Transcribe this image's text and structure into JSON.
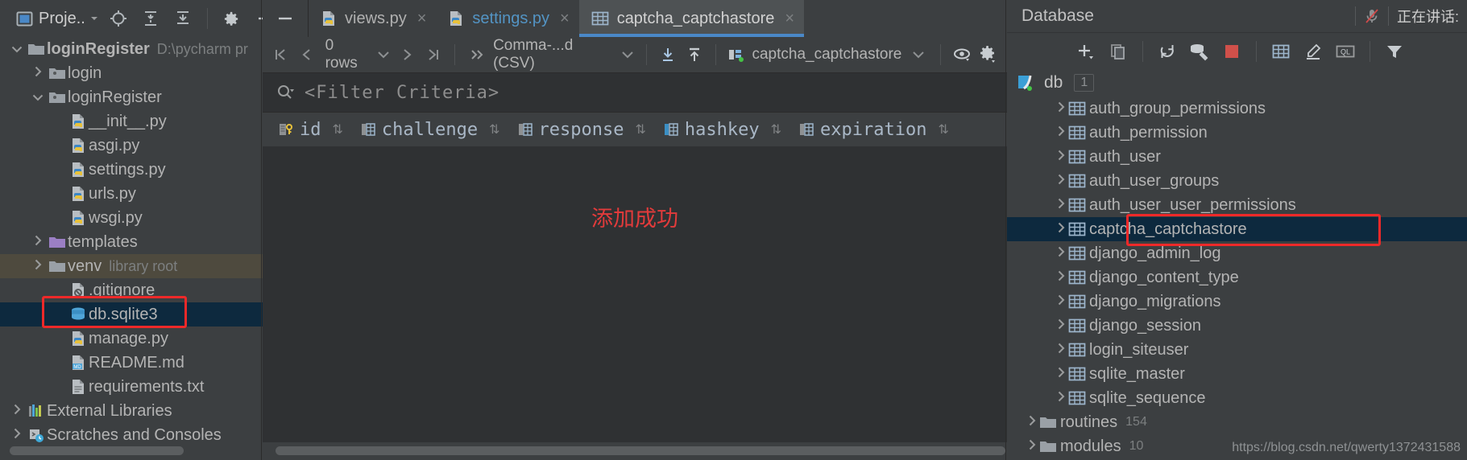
{
  "project_panel": {
    "toolbar": {
      "project_button_label": "Proje..",
      "icons": [
        "project-view-icon",
        "locate-icon",
        "expand-all-icon",
        "collapse-all-icon",
        "settings-gear-icon",
        "hide-icon"
      ]
    },
    "tree": [
      {
        "label": "loginRegister",
        "sub": "D:\\pycharm pr",
        "icon": "folder-icon",
        "arrow": "expanded",
        "indent": 0,
        "style": "bold"
      },
      {
        "label": "login",
        "sub": "",
        "icon": "module-folder-icon",
        "arrow": "collapsed",
        "indent": 1,
        "style": ""
      },
      {
        "label": "loginRegister",
        "sub": "",
        "icon": "module-folder-icon",
        "arrow": "expanded",
        "indent": 1,
        "style": ""
      },
      {
        "label": "__init__.py",
        "sub": "",
        "icon": "python-file-icon",
        "arrow": "",
        "indent": 2,
        "style": ""
      },
      {
        "label": "asgi.py",
        "sub": "",
        "icon": "python-file-icon",
        "arrow": "",
        "indent": 2,
        "style": ""
      },
      {
        "label": "settings.py",
        "sub": "",
        "icon": "python-file-icon",
        "arrow": "",
        "indent": 2,
        "style": "blue"
      },
      {
        "label": "urls.py",
        "sub": "",
        "icon": "python-file-icon",
        "arrow": "",
        "indent": 2,
        "style": ""
      },
      {
        "label": "wsgi.py",
        "sub": "",
        "icon": "python-file-icon",
        "arrow": "",
        "indent": 2,
        "style": ""
      },
      {
        "label": "templates",
        "sub": "",
        "icon": "templates-folder-icon",
        "arrow": "collapsed",
        "indent": 1,
        "style": ""
      },
      {
        "label": "venv",
        "sub": "library root",
        "icon": "folder-icon",
        "arrow": "collapsed",
        "indent": 1,
        "style": "olive",
        "row": "venv"
      },
      {
        "label": ".gitignore",
        "sub": "",
        "icon": "gitignore-file-icon",
        "arrow": "",
        "indent": 2,
        "style": ""
      },
      {
        "label": "db.sqlite3",
        "sub": "",
        "icon": "database-file-icon",
        "arrow": "",
        "indent": 2,
        "style": "olive",
        "row": "db",
        "highlight": "red-box"
      },
      {
        "label": "manage.py",
        "sub": "",
        "icon": "python-file-icon",
        "arrow": "",
        "indent": 2,
        "style": ""
      },
      {
        "label": "README.md",
        "sub": "",
        "icon": "markdown-file-icon",
        "arrow": "",
        "indent": 2,
        "style": ""
      },
      {
        "label": "requirements.txt",
        "sub": "",
        "icon": "text-file-icon",
        "arrow": "",
        "indent": 2,
        "style": ""
      },
      {
        "label": "External Libraries",
        "sub": "",
        "icon": "libraries-icon",
        "arrow": "collapsed",
        "indent": 0,
        "style": ""
      },
      {
        "label": "Scratches and Consoles",
        "sub": "",
        "icon": "scratches-icon",
        "arrow": "collapsed",
        "indent": 0,
        "style": ""
      }
    ]
  },
  "editor": {
    "tabs": [
      {
        "label": "views.py",
        "icon": "python-file-icon",
        "active": false,
        "closable": true
      },
      {
        "label": "settings.py",
        "icon": "python-file-icon",
        "active": false,
        "closable": true,
        "style": "blue"
      },
      {
        "label": "captcha_captchastore",
        "icon": "table-icon",
        "active": true,
        "closable": true
      }
    ],
    "data_toolbar": {
      "first_page_icon": "first-page-icon",
      "prev_page_icon": "prev-page-icon",
      "rows_label": "0 rows",
      "rows_dropdown_icon": "chevron-down-icon",
      "next_page_icon": "next-page-icon",
      "last_page_icon": "last-page-icon",
      "more_icon": "chevron-double-right-icon",
      "format_label": "Comma-...d (CSV)",
      "format_dropdown_icon": "chevron-down-icon",
      "download_icon": "export-data-icon",
      "upload_icon": "import-data-icon",
      "connection_label": "captcha_captchastore",
      "connection_dropdown_icon": "chevron-down-icon",
      "view_icon": "eye-icon",
      "settings_icon": "gear-icon"
    },
    "filter": {
      "search_icon": "search-icon",
      "placeholder": "<Filter Criteria>"
    },
    "grid": {
      "columns": [
        {
          "name": "id",
          "icon": "primary-key-column-icon",
          "sort_icon": "sort-arrows-icon"
        },
        {
          "name": "challenge",
          "icon": "column-icon",
          "sort_icon": "sort-arrows-icon"
        },
        {
          "name": "response",
          "icon": "column-icon",
          "sort_icon": "sort-arrows-icon"
        },
        {
          "name": "hashkey",
          "icon": "column-icon-highlighted",
          "sort_icon": "sort-arrows-icon"
        },
        {
          "name": "expiration",
          "icon": "column-icon",
          "sort_icon": "sort-arrows-icon"
        }
      ],
      "rows": []
    },
    "toast_message": "添加成功"
  },
  "database_panel": {
    "title": "Database",
    "speaking_status": "正在讲话:",
    "mic_icon": "microphone-muted-icon",
    "toolbar_icons": [
      "add-icon",
      "copy-icon",
      "refresh-icon",
      "db-tools-icon",
      "stop-icon",
      "table-icon",
      "edit-icon",
      "ql-console-icon",
      "filter-icon"
    ],
    "connection": {
      "name": "db",
      "icon": "sqlite-datasource-icon",
      "badge": "1"
    },
    "tables": [
      {
        "label": "auth_group_permissions",
        "icon": "table-icon",
        "selected": false
      },
      {
        "label": "auth_permission",
        "icon": "table-icon",
        "selected": false
      },
      {
        "label": "auth_user",
        "icon": "table-icon",
        "selected": false
      },
      {
        "label": "auth_user_groups",
        "icon": "table-icon",
        "selected": false
      },
      {
        "label": "auth_user_user_permissions",
        "icon": "table-icon",
        "selected": false
      },
      {
        "label": "captcha_captchastore",
        "icon": "table-icon",
        "selected": true,
        "highlight": "red-box"
      },
      {
        "label": "django_admin_log",
        "icon": "table-icon",
        "selected": false
      },
      {
        "label": "django_content_type",
        "icon": "table-icon",
        "selected": false
      },
      {
        "label": "django_migrations",
        "icon": "table-icon",
        "selected": false
      },
      {
        "label": "django_session",
        "icon": "table-icon",
        "selected": false
      },
      {
        "label": "login_siteuser",
        "icon": "table-icon",
        "selected": false
      },
      {
        "label": "sqlite_master",
        "icon": "table-icon",
        "selected": false
      },
      {
        "label": "sqlite_sequence",
        "icon": "table-icon",
        "selected": false
      }
    ],
    "groups": [
      {
        "label": "routines",
        "count": "154",
        "icon": "folder-icon"
      },
      {
        "label": "modules",
        "count": "10",
        "icon": "folder-icon"
      }
    ]
  },
  "watermark": "https://blog.csdn.net/qwerty1372431588",
  "colors": {
    "background": "#3c3f41",
    "grid_background": "#2f3133",
    "accent_blue": "#4a88c7",
    "selection_blue": "#0d293e",
    "highlight_red": "#ef2929",
    "toast_red": "#e23b3b",
    "venv_row": "#4e4a3e",
    "text": "#b4b4b4",
    "column_text": "#a9b7c6",
    "olive_text": "#a9b356",
    "link_blue": "#5394c4"
  }
}
